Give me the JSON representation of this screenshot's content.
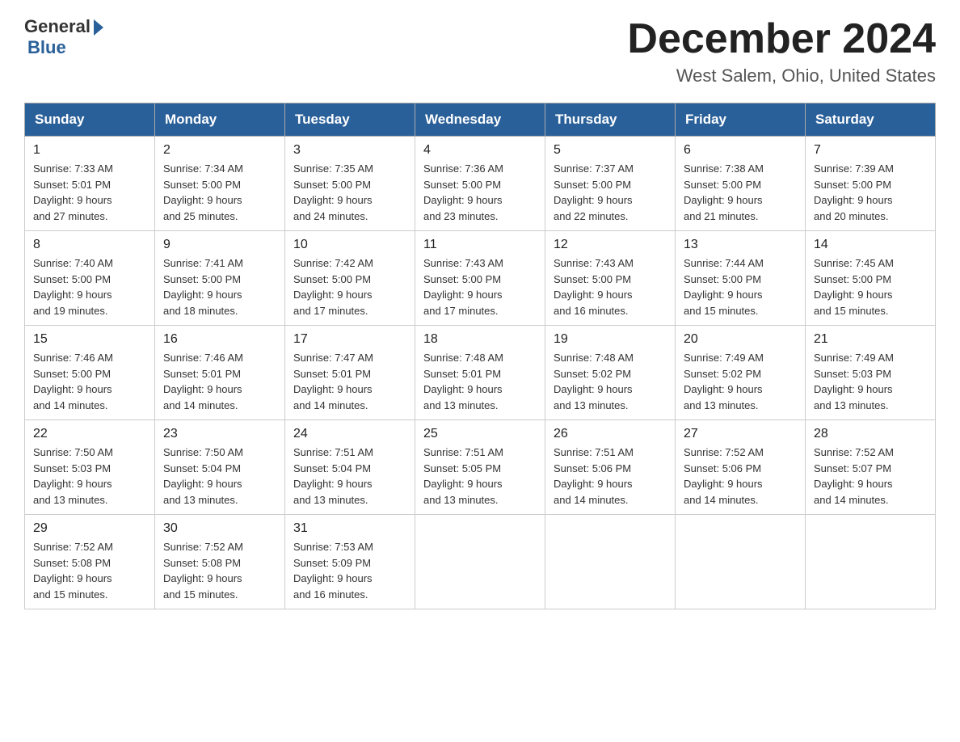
{
  "logo": {
    "general": "General",
    "blue": "Blue"
  },
  "title": "December 2024",
  "subtitle": "West Salem, Ohio, United States",
  "days": [
    "Sunday",
    "Monday",
    "Tuesday",
    "Wednesday",
    "Thursday",
    "Friday",
    "Saturday"
  ],
  "weeks": [
    [
      {
        "num": "1",
        "sunrise": "7:33 AM",
        "sunset": "5:01 PM",
        "daylight": "9 hours and 27 minutes."
      },
      {
        "num": "2",
        "sunrise": "7:34 AM",
        "sunset": "5:00 PM",
        "daylight": "9 hours and 25 minutes."
      },
      {
        "num": "3",
        "sunrise": "7:35 AM",
        "sunset": "5:00 PM",
        "daylight": "9 hours and 24 minutes."
      },
      {
        "num": "4",
        "sunrise": "7:36 AM",
        "sunset": "5:00 PM",
        "daylight": "9 hours and 23 minutes."
      },
      {
        "num": "5",
        "sunrise": "7:37 AM",
        "sunset": "5:00 PM",
        "daylight": "9 hours and 22 minutes."
      },
      {
        "num": "6",
        "sunrise": "7:38 AM",
        "sunset": "5:00 PM",
        "daylight": "9 hours and 21 minutes."
      },
      {
        "num": "7",
        "sunrise": "7:39 AM",
        "sunset": "5:00 PM",
        "daylight": "9 hours and 20 minutes."
      }
    ],
    [
      {
        "num": "8",
        "sunrise": "7:40 AM",
        "sunset": "5:00 PM",
        "daylight": "9 hours and 19 minutes."
      },
      {
        "num": "9",
        "sunrise": "7:41 AM",
        "sunset": "5:00 PM",
        "daylight": "9 hours and 18 minutes."
      },
      {
        "num": "10",
        "sunrise": "7:42 AM",
        "sunset": "5:00 PM",
        "daylight": "9 hours and 17 minutes."
      },
      {
        "num": "11",
        "sunrise": "7:43 AM",
        "sunset": "5:00 PM",
        "daylight": "9 hours and 17 minutes."
      },
      {
        "num": "12",
        "sunrise": "7:43 AM",
        "sunset": "5:00 PM",
        "daylight": "9 hours and 16 minutes."
      },
      {
        "num": "13",
        "sunrise": "7:44 AM",
        "sunset": "5:00 PM",
        "daylight": "9 hours and 15 minutes."
      },
      {
        "num": "14",
        "sunrise": "7:45 AM",
        "sunset": "5:00 PM",
        "daylight": "9 hours and 15 minutes."
      }
    ],
    [
      {
        "num": "15",
        "sunrise": "7:46 AM",
        "sunset": "5:00 PM",
        "daylight": "9 hours and 14 minutes."
      },
      {
        "num": "16",
        "sunrise": "7:46 AM",
        "sunset": "5:01 PM",
        "daylight": "9 hours and 14 minutes."
      },
      {
        "num": "17",
        "sunrise": "7:47 AM",
        "sunset": "5:01 PM",
        "daylight": "9 hours and 14 minutes."
      },
      {
        "num": "18",
        "sunrise": "7:48 AM",
        "sunset": "5:01 PM",
        "daylight": "9 hours and 13 minutes."
      },
      {
        "num": "19",
        "sunrise": "7:48 AM",
        "sunset": "5:02 PM",
        "daylight": "9 hours and 13 minutes."
      },
      {
        "num": "20",
        "sunrise": "7:49 AM",
        "sunset": "5:02 PM",
        "daylight": "9 hours and 13 minutes."
      },
      {
        "num": "21",
        "sunrise": "7:49 AM",
        "sunset": "5:03 PM",
        "daylight": "9 hours and 13 minutes."
      }
    ],
    [
      {
        "num": "22",
        "sunrise": "7:50 AM",
        "sunset": "5:03 PM",
        "daylight": "9 hours and 13 minutes."
      },
      {
        "num": "23",
        "sunrise": "7:50 AM",
        "sunset": "5:04 PM",
        "daylight": "9 hours and 13 minutes."
      },
      {
        "num": "24",
        "sunrise": "7:51 AM",
        "sunset": "5:04 PM",
        "daylight": "9 hours and 13 minutes."
      },
      {
        "num": "25",
        "sunrise": "7:51 AM",
        "sunset": "5:05 PM",
        "daylight": "9 hours and 13 minutes."
      },
      {
        "num": "26",
        "sunrise": "7:51 AM",
        "sunset": "5:06 PM",
        "daylight": "9 hours and 14 minutes."
      },
      {
        "num": "27",
        "sunrise": "7:52 AM",
        "sunset": "5:06 PM",
        "daylight": "9 hours and 14 minutes."
      },
      {
        "num": "28",
        "sunrise": "7:52 AM",
        "sunset": "5:07 PM",
        "daylight": "9 hours and 14 minutes."
      }
    ],
    [
      {
        "num": "29",
        "sunrise": "7:52 AM",
        "sunset": "5:08 PM",
        "daylight": "9 hours and 15 minutes."
      },
      {
        "num": "30",
        "sunrise": "7:52 AM",
        "sunset": "5:08 PM",
        "daylight": "9 hours and 15 minutes."
      },
      {
        "num": "31",
        "sunrise": "7:53 AM",
        "sunset": "5:09 PM",
        "daylight": "9 hours and 16 minutes."
      },
      null,
      null,
      null,
      null
    ]
  ],
  "labels": {
    "sunrise": "Sunrise:",
    "sunset": "Sunset:",
    "daylight": "Daylight:"
  }
}
